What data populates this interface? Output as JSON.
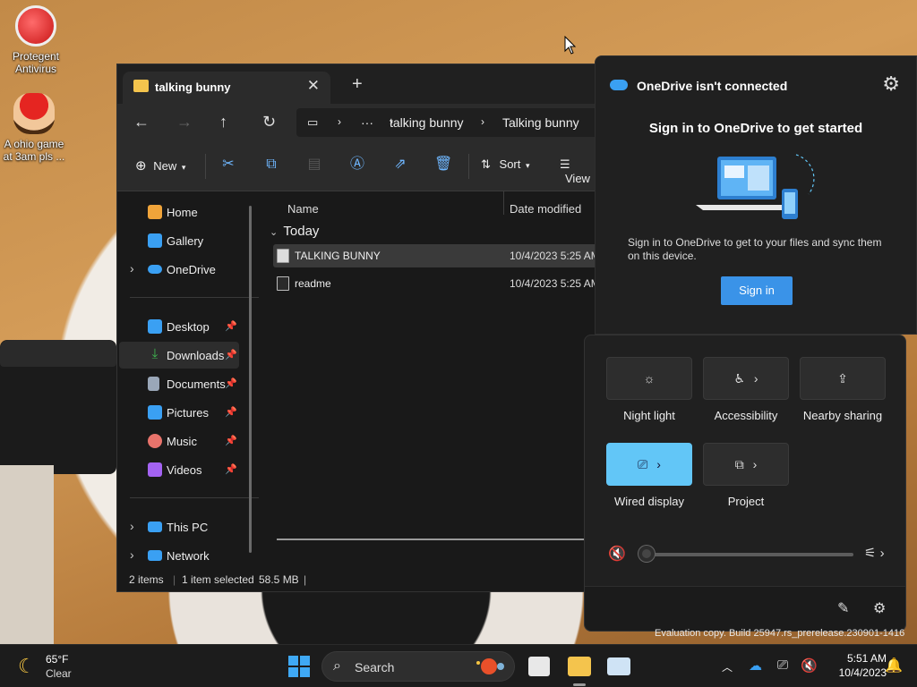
{
  "desktop": {
    "icons": [
      {
        "label": "Protegent Antivirus",
        "icon": "protegent-icon"
      },
      {
        "label": "A ohio game at 3am pls ...",
        "icon": "mario-game-icon"
      }
    ]
  },
  "explorer": {
    "tab_title": "talking bunny",
    "breadcrumb": [
      "talking bunny",
      "Talking bunny"
    ],
    "breadcrumb_more": "···",
    "command_bar": {
      "new_label": "New",
      "sort_label": "Sort",
      "view_label": "View"
    },
    "sidebar": [
      {
        "label": "Home",
        "icon": "home-icon",
        "color": "#f0a43a"
      },
      {
        "label": "Gallery",
        "icon": "gallery-icon",
        "color": "#3aa0f3"
      },
      {
        "label": "OneDrive",
        "icon": "onedrive-icon",
        "color": "#3aa0f3",
        "expandable": true
      },
      {
        "label": "Desktop",
        "icon": "desktop-icon",
        "color": "#3aa0f3",
        "pinned": true
      },
      {
        "label": "Downloads",
        "icon": "downloads-icon",
        "color": "#3fb950",
        "pinned": true,
        "selected": true
      },
      {
        "label": "Documents",
        "icon": "documents-icon",
        "color": "#9aa7b8",
        "pinned": true
      },
      {
        "label": "Pictures",
        "icon": "pictures-icon",
        "color": "#3aa0f3",
        "pinned": true
      },
      {
        "label": "Music",
        "icon": "music-icon",
        "color": "#e8736b",
        "pinned": true
      },
      {
        "label": "Videos",
        "icon": "videos-icon",
        "color": "#a463f2",
        "pinned": true
      },
      {
        "label": "This PC",
        "icon": "this-pc-icon",
        "color": "#3aa0f3",
        "expandable": true
      },
      {
        "label": "Network",
        "icon": "network-icon",
        "color": "#3aa0f3",
        "expandable": true
      }
    ],
    "columns": {
      "name": "Name",
      "date": "Date modified"
    },
    "group_label": "Today",
    "files": [
      {
        "name": "TALKING BUNNY",
        "date": "10/4/2023 5:25 AM",
        "selected": true
      },
      {
        "name": "readme",
        "date": "10/4/2023 5:25 AM",
        "selected": false
      }
    ],
    "status": {
      "count": "2 items",
      "selection": "1 item selected",
      "size": "58.5 MB"
    }
  },
  "onedrive": {
    "title": "OneDrive isn't connected",
    "heading": "Sign in to OneDrive to get started",
    "description": "Sign in to OneDrive to get to your files and sync them on this device.",
    "signin_label": "Sign in"
  },
  "quick_settings": {
    "tiles": [
      {
        "label": "Night light",
        "icon": "night-light-icon",
        "active": false
      },
      {
        "label": "Accessibility",
        "icon": "accessibility-icon",
        "active": false
      },
      {
        "label": "Nearby sharing",
        "icon": "nearby-sharing-icon",
        "active": false
      },
      {
        "label": "Wired display",
        "icon": "wired-display-icon",
        "active": true
      },
      {
        "label": "Project",
        "icon": "project-icon",
        "active": false
      }
    ],
    "volume_level": 0
  },
  "watermark": "Evaluation copy. Build 25947.rs_prerelease.230901-1416",
  "taskbar": {
    "temperature": "65°F",
    "condition": "Clear",
    "search_label": "Search",
    "time": "5:51 AM",
    "date": "10/4/2023"
  },
  "colors": {
    "accent": "#3a93e8",
    "active_tile": "#62c6f7",
    "window_bg": "#191919"
  }
}
